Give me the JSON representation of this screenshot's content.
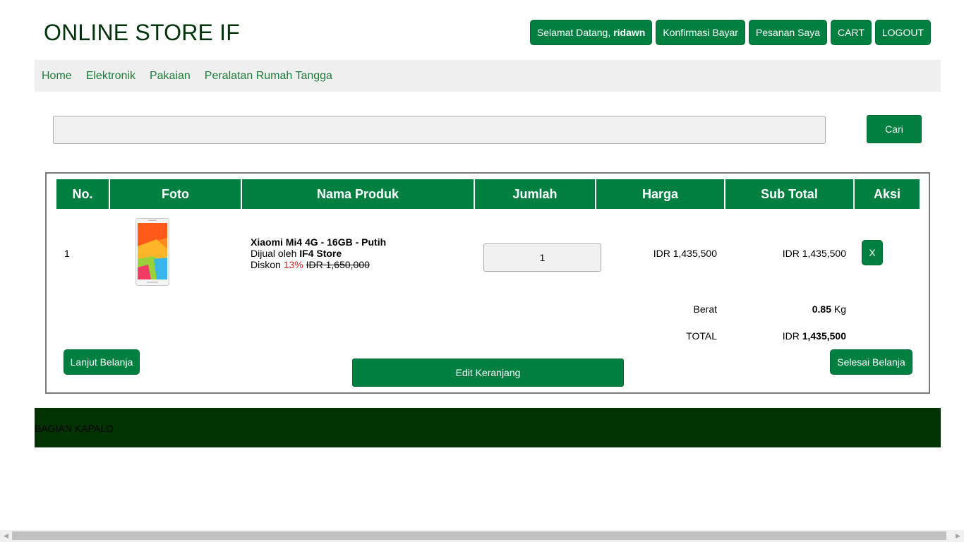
{
  "header": {
    "site_title": "ONLINE STORE IF",
    "welcome_prefix": "Selamat Datang,",
    "username": "ridawn",
    "confirm_payment": "Konfirmasi Bayar",
    "my_orders": "Pesanan Saya",
    "cart": "CART",
    "logout": "LOGOUT"
  },
  "categories": [
    "Home",
    "Elektronik",
    "Pakaian",
    "Peralatan Rumah Tangga"
  ],
  "search": {
    "button_label": "Cari",
    "value": ""
  },
  "cart_table": {
    "columns": [
      "No.",
      "Foto",
      "Nama Produk",
      "Jumlah",
      "Harga",
      "Sub Total",
      "Aksi"
    ],
    "rows": [
      {
        "no": "1",
        "product_name": "Xiaomi Mi4 4G - 16GB - Putih",
        "seller_prefix": "Dijual oleh",
        "seller": "IF4 Store",
        "discount_prefix": "Diskon",
        "discount_pct": "13%",
        "original_price": "IDR 1,650,000",
        "quantity": "1",
        "price": "IDR 1,435,500",
        "subtotal": "IDR 1,435,500",
        "remove_label": "X"
      }
    ],
    "weight_label": "Berat",
    "weight_value": "0.85",
    "weight_unit": "Kg",
    "total_label": "TOTAL",
    "total_currency": "IDR",
    "total_value": "1,435,500"
  },
  "actions": {
    "continue_shopping": "Lanjut Belanja",
    "edit_cart": "Edit Keranjang",
    "finish_shopping": "Selesai Belanja"
  },
  "footer": {
    "text": "BAGIAN KAPALO"
  },
  "colors": {
    "primary": "#008040",
    "footer_bg": "#003300",
    "category_bar": "#efefef",
    "discount": "#e02020"
  }
}
